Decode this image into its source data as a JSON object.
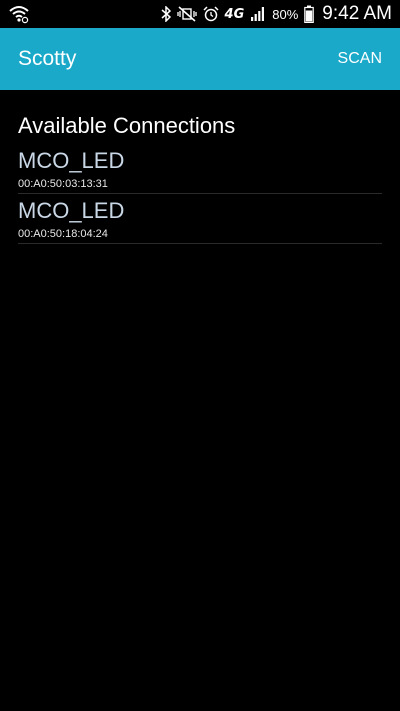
{
  "status_bar": {
    "network_type": "4G",
    "battery_percent": "80%",
    "time": "9:42 AM",
    "icons": [
      "wifi-icon",
      "bluetooth-icon",
      "vibrate-mute-icon",
      "alarm-icon",
      "cell-signal-icon",
      "battery-icon"
    ]
  },
  "app_bar": {
    "title": "Scotty",
    "scan_label": "SCAN",
    "color": "#1aa9c9"
  },
  "main": {
    "heading": "Available Connections",
    "devices": [
      {
        "name": "MCO_LED",
        "address": "00:A0:50:03:13:31"
      },
      {
        "name": "MCO_LED",
        "address": "00:A0:50:18:04:24"
      }
    ]
  }
}
